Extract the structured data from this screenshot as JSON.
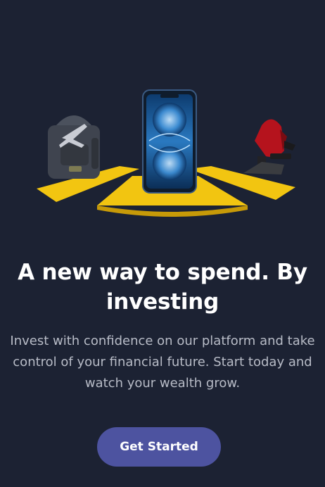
{
  "onboarding": {
    "headline": "A new way to spend. By investing",
    "description": "Invest with confidence on our platform and take control of your financial future. Start today and watch your wealth grow.",
    "cta_label": "Get Started"
  },
  "colors": {
    "background": "#1c2233",
    "heading": "#ffffff",
    "body_text": "#b8bcc7",
    "button": "#4d53a0",
    "podium": "#f2c511"
  }
}
